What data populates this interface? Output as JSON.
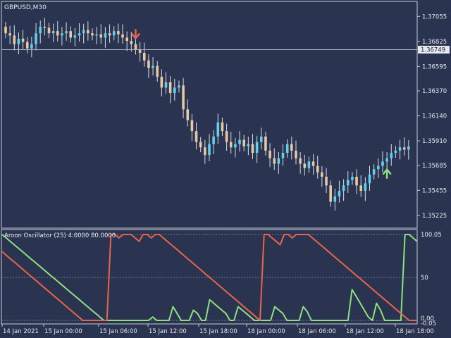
{
  "colors": {
    "background": "#2a3450",
    "frame": "#c8ccd6",
    "text": "#e6e8ee",
    "bull": "#5fd0ee",
    "bear": "#e8c8a0",
    "wick": "#d8dde6",
    "aroon_up": "#8fe07f",
    "aroon_down": "#e8644a",
    "arrow_down": "#e8644a",
    "arrow_up": "#8fe07f"
  },
  "header": {
    "symbol": "GBPUSD,M30"
  },
  "price_scale": {
    "labels": [
      "1.37055",
      "1.36825",
      "1.36595",
      "1.36370",
      "1.36140",
      "1.35910",
      "1.35685",
      "1.35455",
      "1.35225"
    ],
    "current_price": "1.36749"
  },
  "indicator": {
    "title": "Aroon Oscillator (25) 4.0000 80.0000",
    "levels": [
      "100.05",
      "50",
      "0.00",
      "-0.05"
    ]
  },
  "time_axis": {
    "labels": [
      "14 Jan 2021",
      "15 Jan 00:00",
      "15 Jan 06:00",
      "15 Jan 12:00",
      "15 Jan 18:00",
      "18 Jan 00:00",
      "18 Jan 06:00",
      "18 Jan 12:00",
      "18 Jan 18:00"
    ]
  },
  "chart_data": [
    {
      "type": "candlestick",
      "title": "GBPUSD,M30",
      "ylim": [
        1.3512,
        1.3718
      ],
      "current_price": 1.36749,
      "close_series": [
        1.369,
        1.3688,
        1.368,
        1.3685,
        1.3682,
        1.3676,
        1.368,
        1.369,
        1.3696,
        1.3695,
        1.369,
        1.3692,
        1.3688,
        1.369,
        1.3692,
        1.3686,
        1.3688,
        1.369,
        1.3693,
        1.369,
        1.3688,
        1.3689,
        1.3686,
        1.369,
        1.3688,
        1.3692,
        1.3689,
        1.3686,
        1.3683,
        1.368,
        1.3675,
        1.3672,
        1.3665,
        1.3658,
        1.366,
        1.365,
        1.364,
        1.3645,
        1.3635,
        1.364,
        1.3642,
        1.362,
        1.361,
        1.36,
        1.359,
        1.3585,
        1.3578,
        1.3588,
        1.3595,
        1.3608,
        1.36,
        1.359,
        1.3585,
        1.3588,
        1.3592,
        1.3586,
        1.3588,
        1.358,
        1.359,
        1.3595,
        1.3582,
        1.3575,
        1.357,
        1.3575,
        1.358,
        1.3588,
        1.3582,
        1.3575,
        1.357,
        1.3566,
        1.3572,
        1.3568,
        1.3562,
        1.3558,
        1.355,
        1.3535,
        1.354,
        1.3545,
        1.355,
        1.3555,
        1.3558,
        1.355,
        1.3545,
        1.3552,
        1.356,
        1.3565,
        1.3568,
        1.3572,
        1.3575,
        1.358,
        1.3582,
        1.3585,
        1.3583,
        1.3586
      ],
      "signal_arrows": [
        {
          "direction": "down",
          "close_index": 30
        },
        {
          "direction": "up",
          "close_index": 88
        }
      ]
    },
    {
      "type": "line",
      "title": "Aroon Oscillator (25) 4.0000 80.0000",
      "ylim": [
        0,
        100
      ],
      "levels": [
        100,
        50,
        0
      ],
      "series": [
        {
          "color": "#8fe07f",
          "values": [
            100,
            96,
            92,
            88,
            84,
            80,
            76,
            72,
            68,
            64,
            60,
            56,
            52,
            48,
            44,
            40,
            36,
            32,
            28,
            24,
            20,
            16,
            12,
            8,
            4,
            0,
            0,
            0,
            0,
            0,
            0,
            0,
            0,
            0,
            0,
            0,
            0,
            4,
            0,
            0,
            0,
            0,
            16,
            8,
            0,
            0,
            0,
            12,
            8,
            0,
            0,
            24,
            20,
            16,
            12,
            8,
            0,
            0,
            16,
            12,
            8,
            4,
            0,
            0,
            0,
            0,
            0,
            16,
            12,
            8,
            0,
            0,
            0,
            0,
            16,
            10,
            0,
            0,
            0,
            0,
            0,
            0,
            0,
            0,
            0,
            0,
            36,
            28,
            20,
            12,
            4,
            0,
            20,
            12,
            0,
            0,
            0,
            0,
            0,
            100,
            100,
            96,
            92
          ]
        },
        {
          "color": "#e8644a",
          "values": [
            80,
            76,
            72,
            68,
            64,
            60,
            56,
            52,
            48,
            44,
            40,
            36,
            32,
            28,
            24,
            20,
            16,
            12,
            8,
            4,
            0,
            0,
            0,
            0,
            0,
            0,
            0,
            100,
            100,
            96,
            100,
            100,
            100,
            96,
            92,
            100,
            100,
            96,
            100,
            100,
            96,
            92,
            88,
            84,
            80,
            76,
            72,
            68,
            64,
            60,
            56,
            52,
            48,
            44,
            40,
            36,
            32,
            28,
            24,
            20,
            16,
            12,
            8,
            4,
            0,
            100,
            100,
            96,
            92,
            88,
            100,
            100,
            96,
            100,
            100,
            100,
            100,
            96,
            92,
            88,
            84,
            80,
            76,
            72,
            68,
            64,
            60,
            56,
            52,
            48,
            44,
            40,
            36,
            32,
            28,
            24,
            20,
            16,
            12,
            8,
            4,
            0,
            0,
            0
          ]
        }
      ]
    }
  ]
}
